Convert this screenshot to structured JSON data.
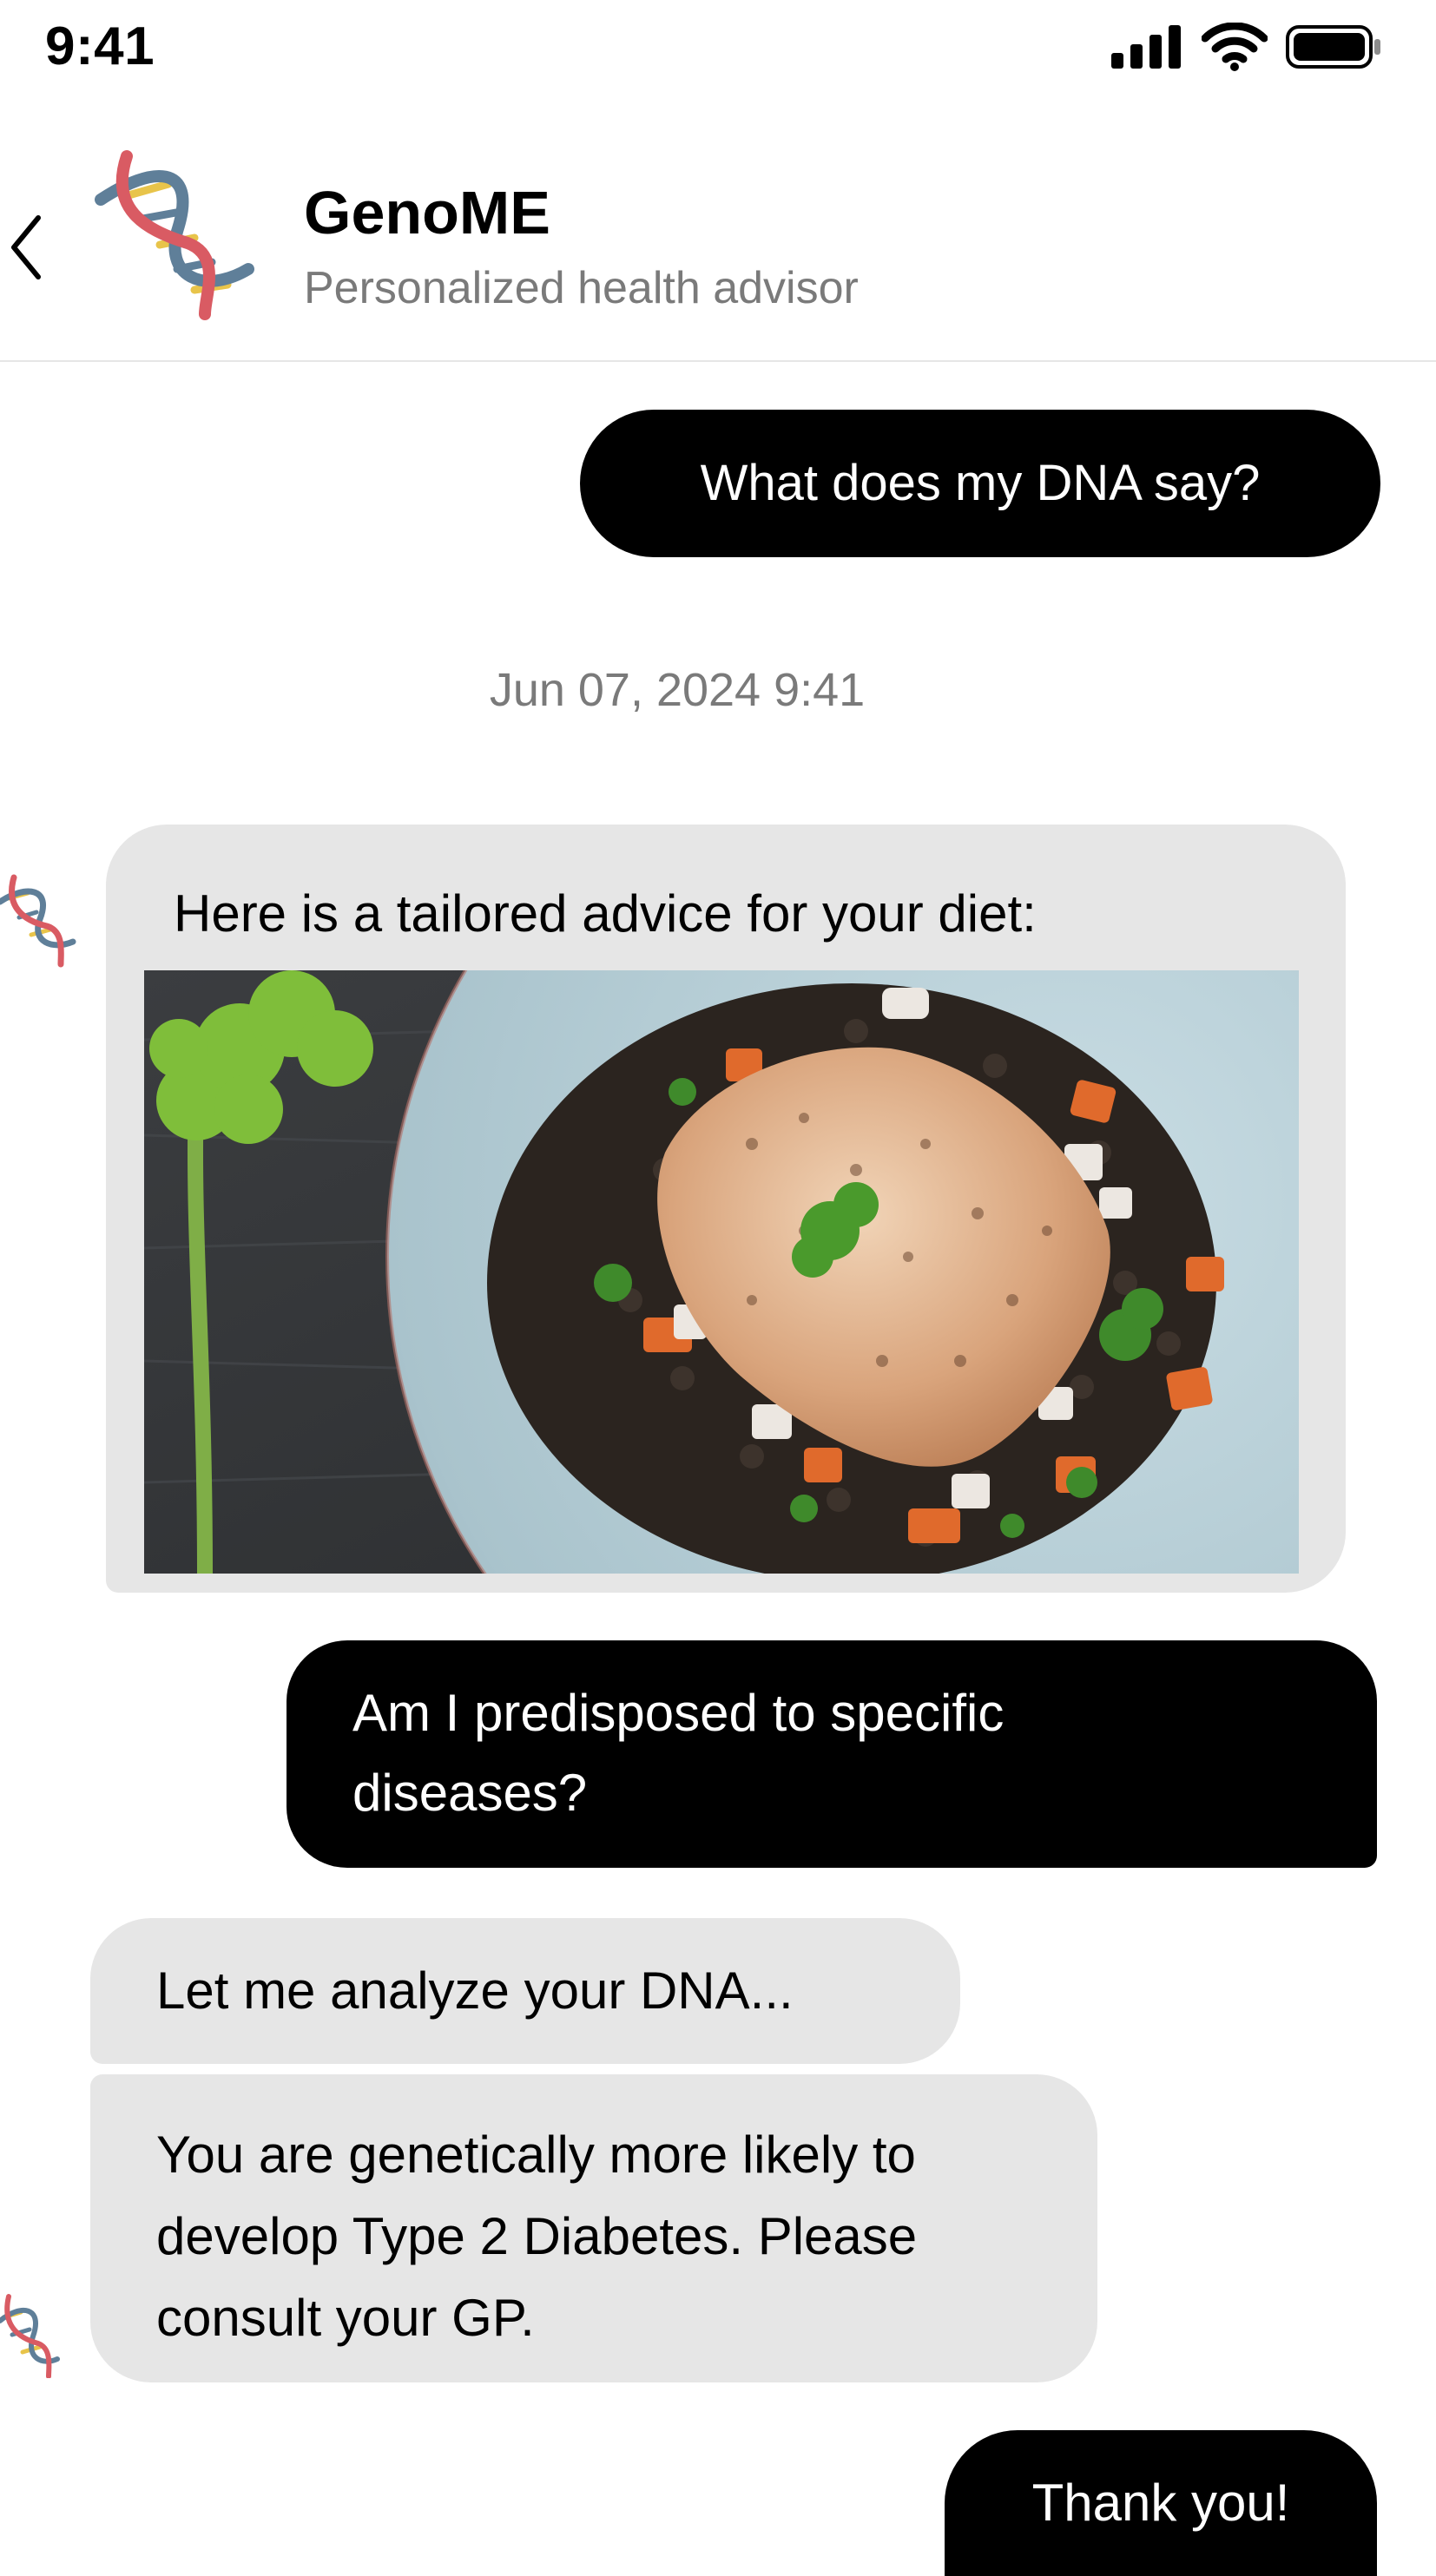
{
  "status_bar": {
    "time": "9:41",
    "icons": [
      "signal-icon",
      "wifi-icon",
      "battery-icon"
    ]
  },
  "header": {
    "title": "GenoME",
    "subtitle": "Personalized health advisor",
    "back_icon": "chevron-left-icon",
    "logo_icon": "dna-icon"
  },
  "messages": [
    {
      "sender": "user",
      "text": "What does my DNA say?"
    },
    {
      "sender": "bot",
      "text": "Here is a tailored advice for your diet:",
      "image": "food-photo"
    },
    {
      "sender": "user",
      "text": "Am I predisposed to specific diseases?"
    },
    {
      "sender": "bot",
      "text": "Let me analyze your DNA..."
    },
    {
      "sender": "bot",
      "text": "You are genetically more likely to develop Type 2 Diabetes. Please consult your GP."
    },
    {
      "sender": "user",
      "text": "Thank you!"
    }
  ],
  "timestamp": "Jun 07, 2024 9:41",
  "colors": {
    "user_bubble": "#000000",
    "bot_bubble": "#e6e6e6",
    "muted_text": "#7a7a7a",
    "dna_red": "#d95b63",
    "dna_blue": "#5f7f99",
    "dna_yellow": "#e8c44a"
  }
}
